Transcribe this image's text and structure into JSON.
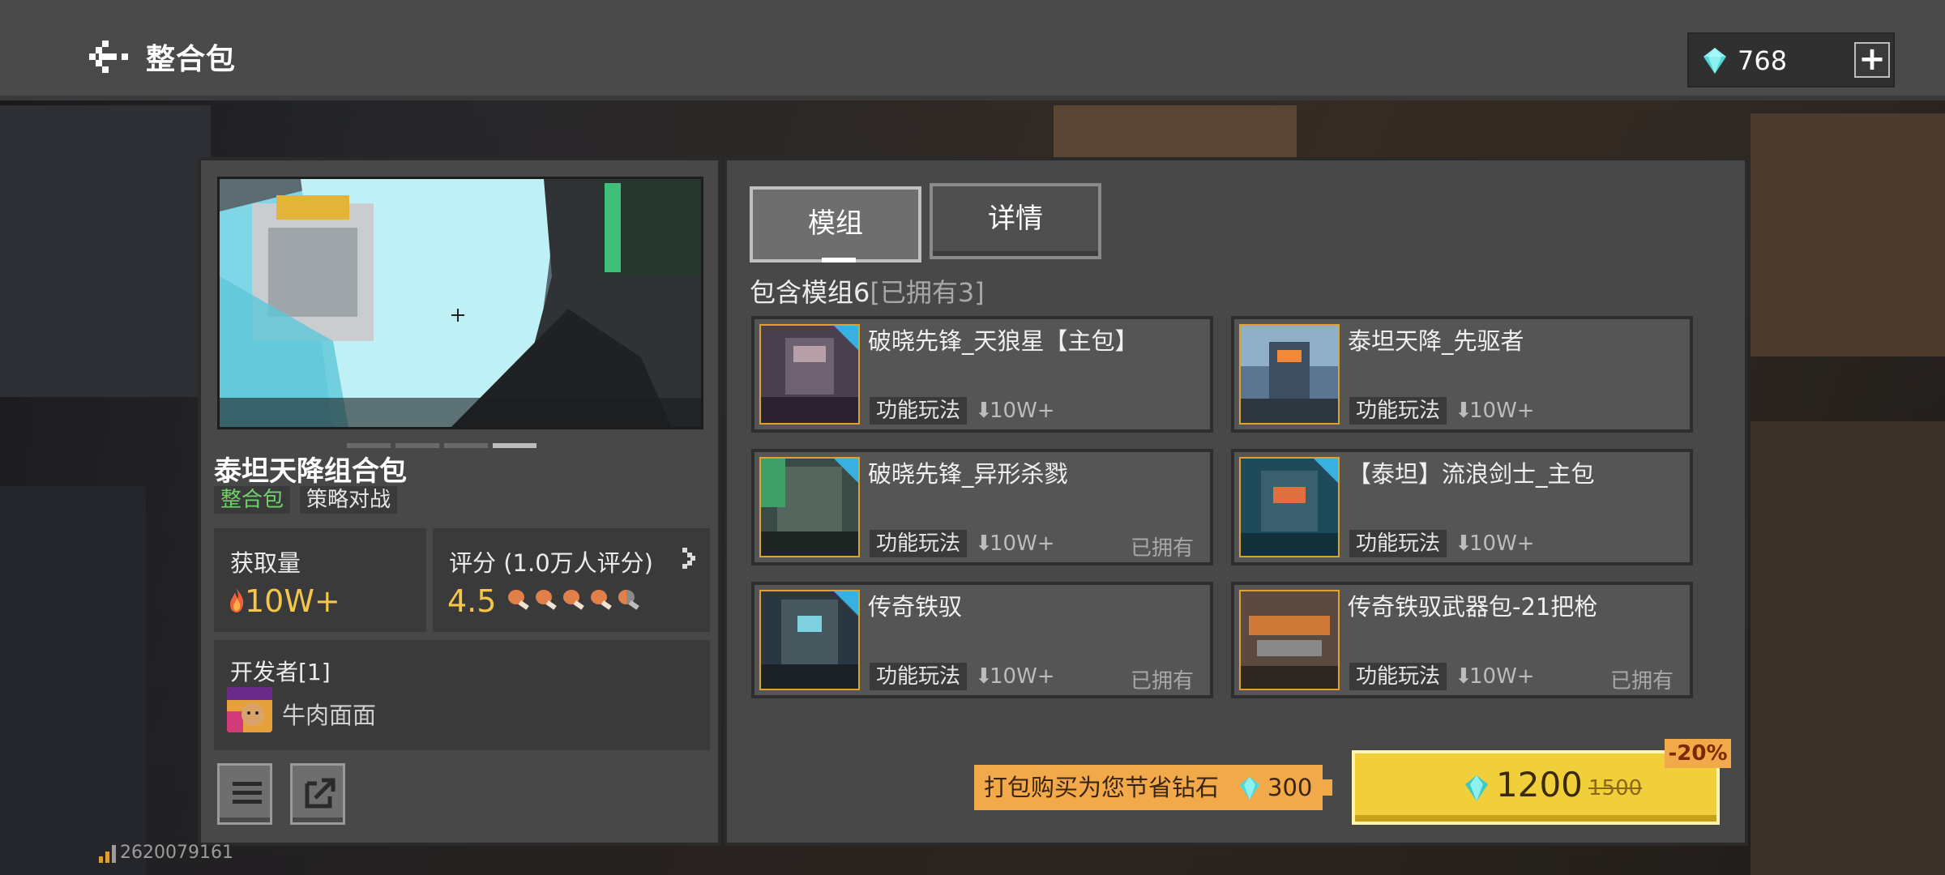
{
  "header": {
    "title": "整合包",
    "diamonds": "768",
    "add_label": "+"
  },
  "pack": {
    "title": "泰坦天降组合包",
    "tags": [
      "整合包",
      "策略对战"
    ],
    "downloads_label": "获取量",
    "downloads_value": "10W+",
    "rating_label": "评分 (1.0万人评分)",
    "rating_value": "4.5",
    "rating_stars": 4.5,
    "developer_label": "开发者[1]",
    "developer_name": "牛肉面面",
    "carousel_index": 4,
    "carousel_total": 4
  },
  "tabs": [
    "模组",
    "详情"
  ],
  "contents": {
    "label": "包含模组6",
    "owned": "[已拥有3]"
  },
  "mods": [
    {
      "name": "破晓先锋_天狼星【主包】",
      "tag": "功能玩法",
      "downloads": "10W+",
      "owned": ""
    },
    {
      "name": "泰坦天降_先驱者",
      "tag": "功能玩法",
      "downloads": "10W+",
      "owned": ""
    },
    {
      "name": "破晓先锋_异形杀戮",
      "tag": "功能玩法",
      "downloads": "10W+",
      "owned": "已拥有"
    },
    {
      "name": "【泰坦】流浪剑士_主包",
      "tag": "功能玩法",
      "downloads": "10W+",
      "owned": ""
    },
    {
      "name": "传奇铁驭",
      "tag": "功能玩法",
      "downloads": "10W+",
      "owned": "已拥有"
    },
    {
      "name": "传奇铁驭武器包-21把枪",
      "tag": "功能玩法",
      "downloads": "10W+",
      "owned": "已拥有"
    }
  ],
  "purchase": {
    "save_text": "打包购买为您节省钻石",
    "save_amount": "300",
    "price": "1200",
    "original_price": "1500",
    "discount": "-20%"
  },
  "footer": {
    "id_text": "2620079161"
  },
  "colors": {
    "accent_gold": "#f1cf3a",
    "banner_orange": "#f2a94a",
    "tag_green": "#6fd26b",
    "rating_gold": "#f4c64a"
  }
}
